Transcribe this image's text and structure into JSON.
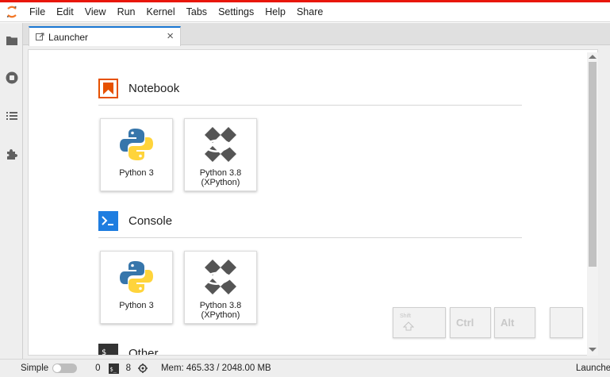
{
  "menu": [
    "File",
    "Edit",
    "View",
    "Run",
    "Kernel",
    "Tabs",
    "Settings",
    "Help",
    "Share"
  ],
  "sidebar_icons": [
    "folder-icon",
    "stop-circle-icon",
    "list-icon",
    "puzzle-icon"
  ],
  "tab": {
    "label": "Launcher",
    "close": "×"
  },
  "sections": {
    "notebook": {
      "title": "Notebook",
      "cards": [
        {
          "label": "Python 3"
        },
        {
          "label": "Python 3.8\n(XPython)"
        }
      ]
    },
    "console": {
      "title": "Console",
      "cards": [
        {
          "label": "Python 3"
        },
        {
          "label": "Python 3.8\n(XPython)"
        }
      ]
    },
    "other": {
      "title": "Other"
    }
  },
  "keys": {
    "shift": "Shift",
    "ctrl": "Ctrl",
    "alt": "Alt"
  },
  "status": {
    "mode": "Simple",
    "terminals": "0",
    "kernels": "8",
    "memory": "Mem: 465.33 / 2048.00 MB",
    "right": "Launcher"
  },
  "colors": {
    "accent_red": "#e8160a",
    "tab_blue": "#1976d2",
    "notebook_orange": "#e65100",
    "console_blue": "#1e7de0"
  }
}
